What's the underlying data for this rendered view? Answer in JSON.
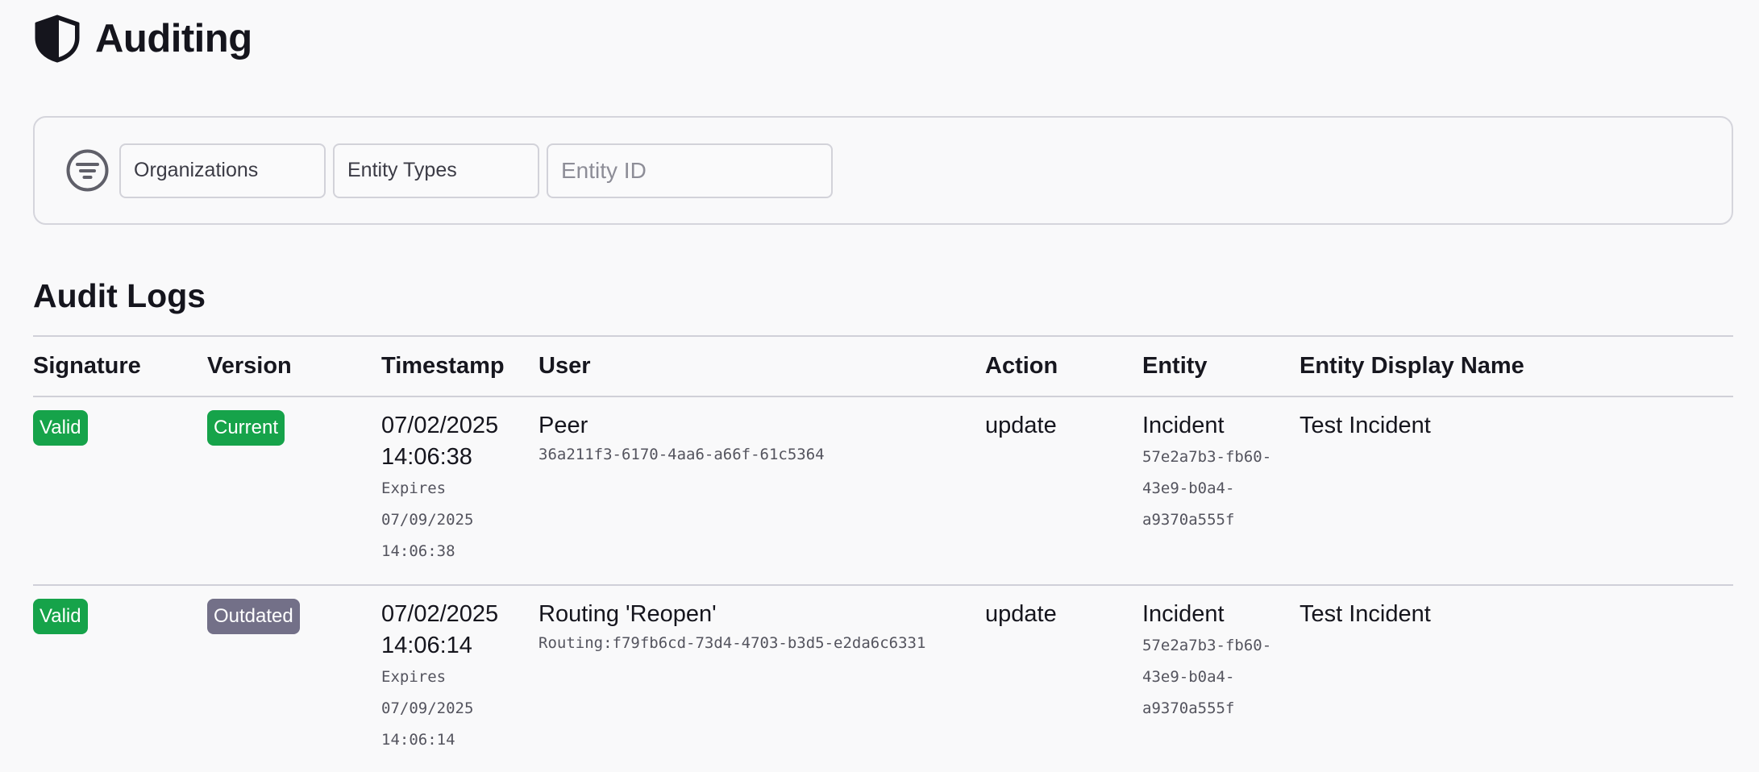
{
  "header": {
    "title": "Auditing",
    "icon": "shield-icon"
  },
  "filters": {
    "icon": "filter-icon",
    "organizations_label": "Organizations",
    "entity_types_label": "Entity Types",
    "entity_id_placeholder": "Entity ID",
    "entity_id_value": ""
  },
  "audit_logs": {
    "title": "Audit Logs",
    "columns": {
      "signature": "Signature",
      "version": "Version",
      "timestamp": "Timestamp",
      "user": "User",
      "action": "Action",
      "entity": "Entity",
      "entity_display_name": "Entity Display Name"
    },
    "rows": [
      {
        "signature": "Valid",
        "version": "Current",
        "version_color": "#16a34a",
        "timestamp_date": "07/02/2025",
        "timestamp_time": "14:06:38",
        "expires_label": "Expires",
        "expires_date": "07/09/2025",
        "expires_time": "14:06:38",
        "user_name": "Peer",
        "user_id": "36a211f3-6170-4aa6-a66f-61c5364",
        "action": "update",
        "entity_type": "Incident",
        "entity_id_1": "57e2a7b3-fb60-",
        "entity_id_2": "43e9-b0a4-",
        "entity_id_3": "a9370a555f",
        "entity_display_name": "Test Incident"
      },
      {
        "signature": "Valid",
        "version": "Outdated",
        "version_color": "#737088",
        "timestamp_date": "07/02/2025",
        "timestamp_time": "14:06:14",
        "expires_label": "Expires",
        "expires_date": "07/09/2025",
        "expires_time": "14:06:14",
        "user_name": "Routing 'Reopen'",
        "user_id": "Routing:f79fb6cd-73d4-4703-b3d5-e2da6c6331",
        "action": "update",
        "entity_type": "Incident",
        "entity_id_1": "57e2a7b3-fb60-",
        "entity_id_2": "43e9-b0a4-",
        "entity_id_3": "a9370a555f",
        "entity_display_name": "Test Incident"
      }
    ]
  },
  "colors": {
    "valid_badge": "#16a34a",
    "current_badge": "#16a34a",
    "outdated_badge": "#737088",
    "border": "#d0d0d8",
    "background": "#f9f9fa"
  }
}
